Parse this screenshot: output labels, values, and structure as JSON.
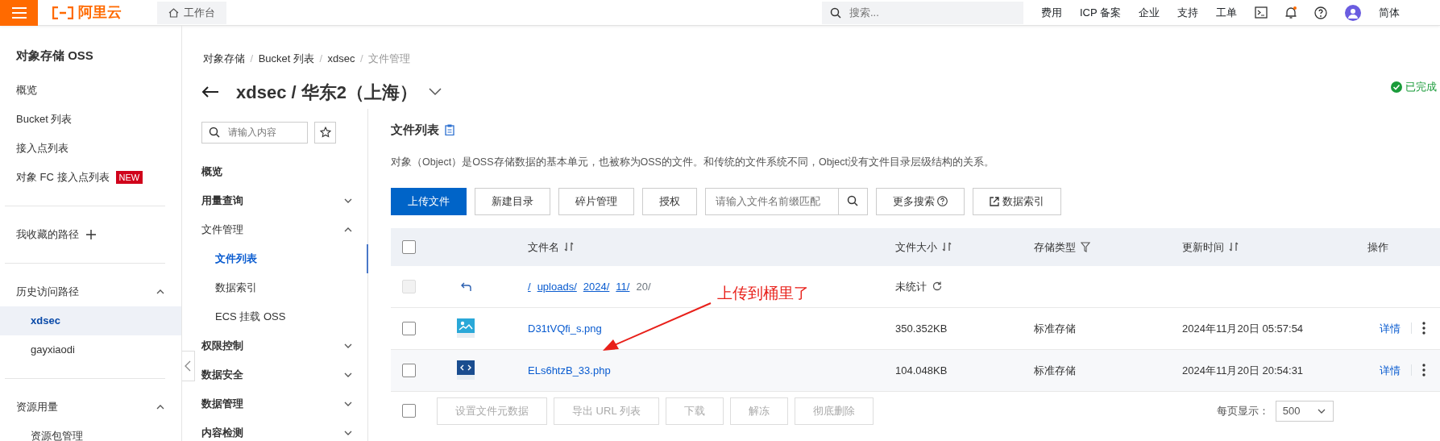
{
  "topbar": {
    "logo_text": "阿里云",
    "workbench": "工作台",
    "search_placeholder": "搜索...",
    "links": [
      "费用",
      "ICP 备案",
      "企业",
      "支持",
      "工单"
    ],
    "language": "简体"
  },
  "sidebar": {
    "title": "对象存储 OSS",
    "items": [
      {
        "label": "概览"
      },
      {
        "label": "Bucket 列表"
      },
      {
        "label": "接入点列表"
      },
      {
        "label": "对象 FC 接入点列表",
        "badge": "NEW"
      }
    ],
    "favorites": "我收藏的路径",
    "history": {
      "label": "历史访问路径",
      "expanded": true,
      "items": [
        {
          "label": "xdsec",
          "selected": true
        },
        {
          "label": "gayxiaodi",
          "selected": false
        }
      ]
    },
    "resources": {
      "label": "资源用量",
      "expanded": true,
      "items": [
        {
          "label": "资源包管理",
          "selected": false
        }
      ]
    }
  },
  "breadcrumb": [
    {
      "label": "对象存储",
      "kind": "link"
    },
    {
      "label": "/",
      "kind": "separator"
    },
    {
      "label": "Bucket 列表",
      "kind": "link"
    },
    {
      "label": "/",
      "kind": "separator"
    },
    {
      "label": "xdsec",
      "kind": "link"
    },
    {
      "label": "/",
      "kind": "separator"
    },
    {
      "label": "文件管理",
      "kind": "current"
    }
  ],
  "page_title": "xdsec / 华东2（上海）",
  "status": "已完成",
  "bucket_nav": {
    "search_placeholder": "请输入内容",
    "items": [
      {
        "label": "概览",
        "kind": "link"
      },
      {
        "label": "用量查询",
        "kind": "group",
        "expanded": false
      },
      {
        "label": "文件管理",
        "kind": "group",
        "expanded": true,
        "children": [
          {
            "label": "文件列表",
            "selected": true
          },
          {
            "label": "数据索引",
            "selected": false
          },
          {
            "label": "ECS 挂载 OSS",
            "selected": false
          }
        ]
      },
      {
        "label": "权限控制",
        "kind": "group",
        "expanded": false
      },
      {
        "label": "数据安全",
        "kind": "group",
        "expanded": false
      },
      {
        "label": "数据管理",
        "kind": "group",
        "expanded": false
      },
      {
        "label": "内容检测",
        "kind": "group",
        "expanded": false
      }
    ]
  },
  "main": {
    "title": "文件列表",
    "description": "对象（Object）是OSS存储数据的基本单元，也被称为OSS的文件。和传统的文件系统不同，Object没有文件目录层级结构的关系。",
    "toolbar": [
      {
        "label": "上传文件",
        "kind": "primary"
      },
      {
        "label": "新建目录",
        "kind": "plain"
      },
      {
        "label": "碎片管理",
        "kind": "plain"
      },
      {
        "label": "授权",
        "kind": "plain"
      }
    ],
    "search_placeholder": "请输入文件名前缀匹配",
    "more_search": "更多搜索",
    "data_index": "数据索引",
    "table": {
      "select_all_checked": false,
      "columns": [
        {
          "label": "文件名",
          "kind": "sortable"
        },
        {
          "label": "文件大小",
          "kind": "sortable"
        },
        {
          "label": "存储类型",
          "kind": "filterable"
        },
        {
          "label": "更新时间",
          "kind": "sortable"
        },
        {
          "label": "操作",
          "kind": "plain"
        }
      ],
      "parent_row": {
        "path": [
          "/",
          "uploads/",
          "2024/",
          "11/"
        ],
        "current": "20/",
        "size": "未统计",
        "disabled": true
      },
      "rows": [
        {
          "name": "D31tVQfi_s.png",
          "kind": "image",
          "size": "350.352KB",
          "storage": "标准存储",
          "updated": "2024年11月20日 05:57:54",
          "action": "详情",
          "checked": false
        },
        {
          "name": "ELs6htzB_33.php",
          "kind": "code",
          "size": "104.048KB",
          "storage": "标准存储",
          "updated": "2024年11月20日 20:54:31",
          "action": "详情",
          "checked": false
        }
      ]
    },
    "footer_checked": false,
    "bulk_actions": [
      {
        "label": "设置文件元数据",
        "disabled": true
      },
      {
        "label": "导出 URL 列表",
        "disabled": true
      },
      {
        "label": "下载",
        "disabled": true
      },
      {
        "label": "解冻",
        "disabled": true
      },
      {
        "label": "彻底删除",
        "disabled": true
      }
    ],
    "page_size_label": "每页显示：",
    "page_size": "500"
  },
  "annotation": {
    "text": "上传到桶里了"
  }
}
